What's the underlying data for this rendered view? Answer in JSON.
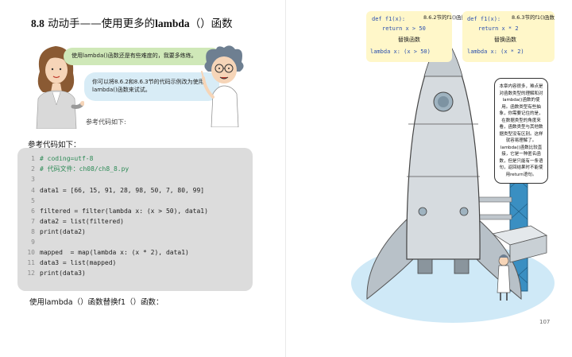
{
  "left_page": {
    "section_number": "8.8",
    "section_title_a": " 动动手——使用更多的",
    "section_title_bold": "lambda",
    "section_title_b": "（）函数",
    "bubble_1": "使用lambda()函数还是有些难度的，我要多练练。",
    "bubble_2": "你可以将8.6.2和8.6.3节的代码示例改为使用lambda()函数来试试。",
    "ref_caption_small": "参考代码如下:",
    "ref_caption": "参考代码如下：",
    "code_lines": [
      {
        "num": "1",
        "text": "# coding=utf-8"
      },
      {
        "num": "2",
        "text": "# 代码文件：ch08/ch8_8.py"
      },
      {
        "num": "3",
        "text": ""
      },
      {
        "num": "4",
        "text": "data1 = [66, 15, 91, 28, 98, 50, 7, 80, 99]"
      },
      {
        "num": "5",
        "text": ""
      },
      {
        "num": "6",
        "text": "filtered = filter(lambda x: (x > 50), data1)"
      },
      {
        "num": "7",
        "text": "data2 = list(filtered)"
      },
      {
        "num": "8",
        "text": "print(data2)"
      },
      {
        "num": "9",
        "text": ""
      },
      {
        "num": "10",
        "text": "mapped  = map(lambda x: (x * 2), data1)"
      },
      {
        "num": "11",
        "text": "data3 = list(mapped)"
      },
      {
        "num": "12",
        "text": "print(data3)"
      }
    ],
    "replace_caption": "使用lambda（）函数替换f1（）函数："
  },
  "right_page": {
    "note_1": {
      "line1": "def f1(x):",
      "tag": "8.6.2节的f1()函数",
      "line2": "return x > 50",
      "label": "替换函数",
      "line3": "lambda x: (x > 50)"
    },
    "note_2": {
      "line1": "def f1(x):",
      "tag": "8.6.3节的f1()函数",
      "line2": "return x * 2",
      "label": "替换函数",
      "line3": "lambda x: (x * 2)"
    },
    "info_text": "本章内容很多，难点是对函数类型的理解和对lambda()函数的使用。函数类型有些抽象，你需要记住的是，在数据类型的角度来看，函数类型与其他数据类型没有区别。这样就容易理解了。lambda()函数比较直接，它是一种匿名函数，但是只能有一条语句，返回结果时不能使用return语句。",
    "page_number": "107"
  }
}
